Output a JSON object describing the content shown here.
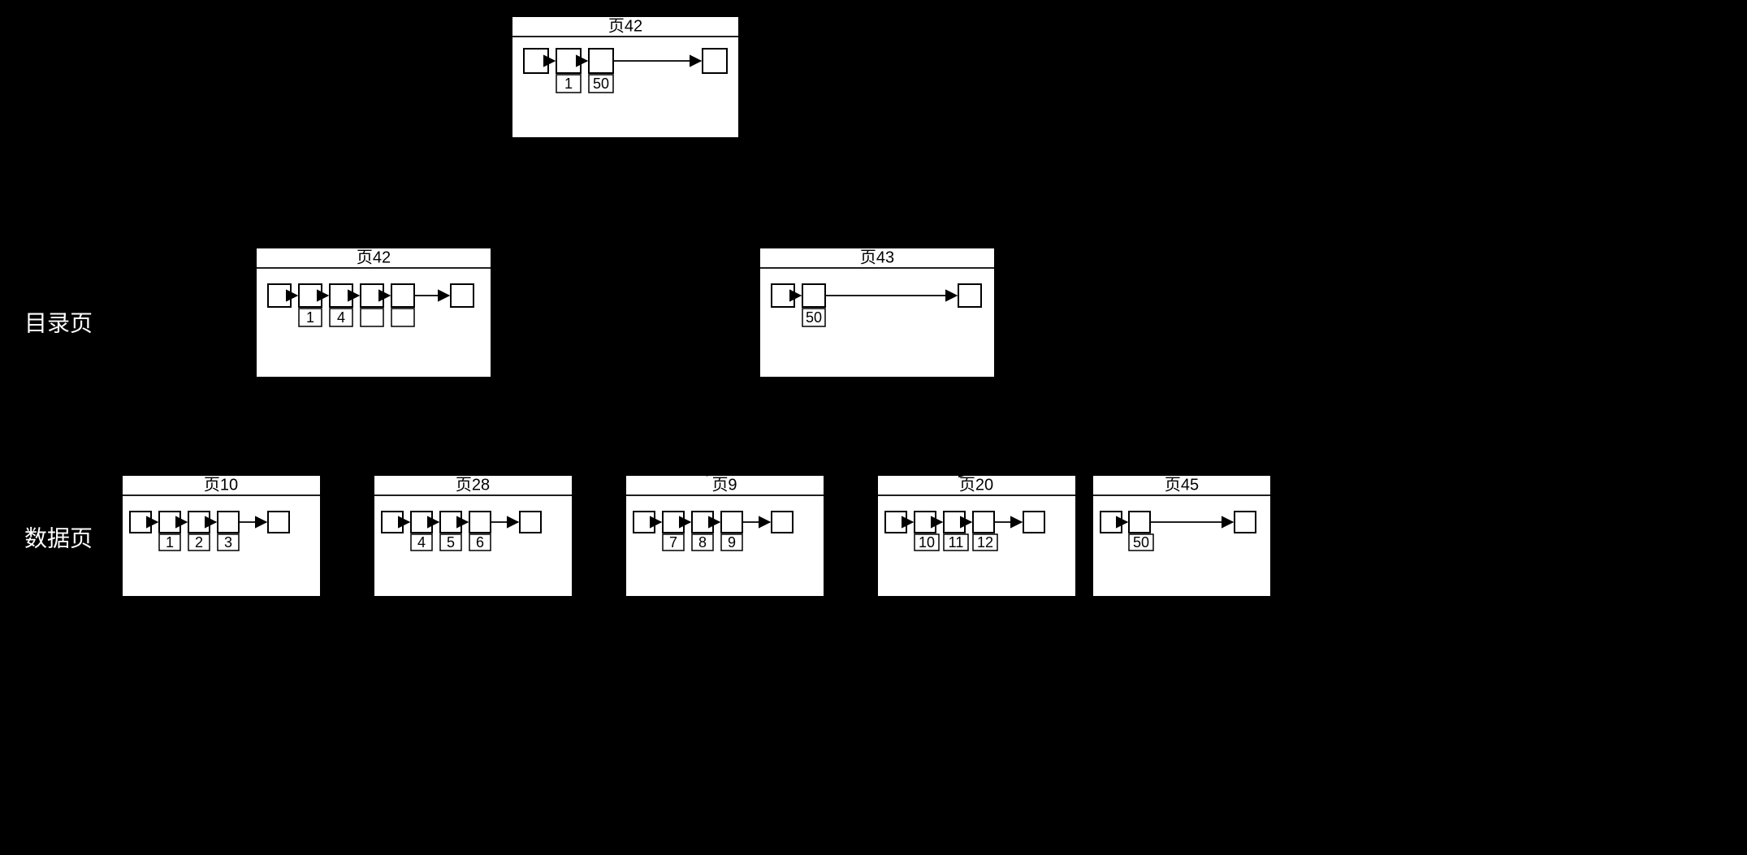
{
  "labels": {
    "directory": "目录页",
    "data": "数据页"
  },
  "panels": {
    "top": {
      "title": "页42",
      "sub": [
        "1",
        "50"
      ]
    },
    "mid1": {
      "title": "页42",
      "sub": [
        "1",
        "4"
      ]
    },
    "mid2": {
      "title": "页43",
      "sub": [
        "50"
      ]
    },
    "d10": {
      "title": "页10",
      "sub": [
        "1",
        "2",
        "3"
      ]
    },
    "d28": {
      "title": "页28",
      "sub": [
        "4",
        "5",
        "6"
      ]
    },
    "d9": {
      "title": "页9",
      "sub": [
        "7",
        "8",
        "9"
      ]
    },
    "d20": {
      "title": "页20",
      "sub": [
        "10",
        "11",
        "12"
      ]
    },
    "d45": {
      "title": "页45",
      "sub": [
        "50"
      ]
    }
  }
}
